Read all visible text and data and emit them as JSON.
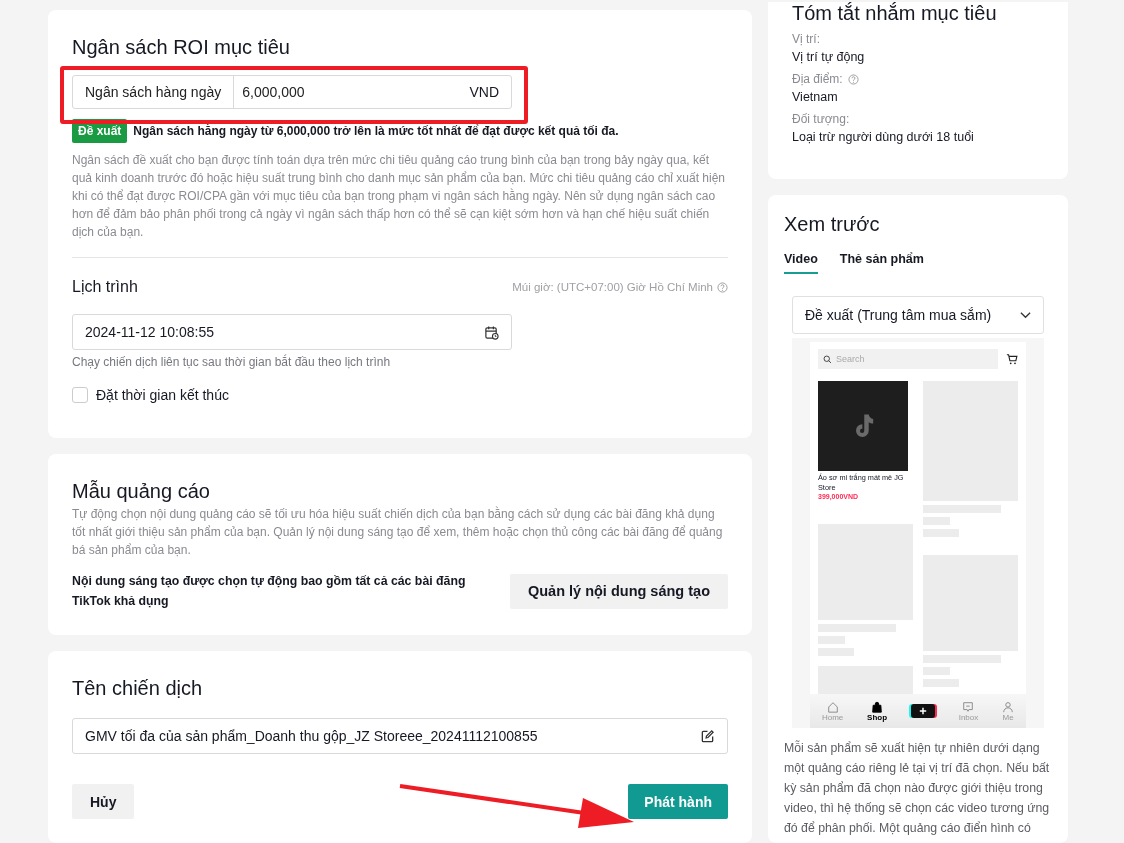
{
  "budget_card": {
    "title": "Ngân sách ROI mục tiêu",
    "budget_field": {
      "label": "Ngân sách hàng ngày",
      "value": "6,000,000",
      "unit": "VND"
    },
    "suggestion": {
      "badge": "Đề xuất",
      "text": "Ngân sách hằng ngày từ 6,000,000 trở lên là mức tốt nhất để đạt được kết quả tối đa."
    },
    "description": "Ngân sách đề xuất cho bạn được tính toán dựa trên mức chi tiêu quảng cáo trung bình của bạn trong bảy ngày qua, kết quả kinh doanh trước đó hoặc hiệu suất trung bình cho danh mục sản phẩm của bạn. Mức chi tiêu quảng cáo chỉ xuất hiện khi có thể đạt được ROI/CPA gần với mục tiêu của bạn trong phạm vi ngân sách hằng ngày. Nên sử dụng ngân sách cao hơn để đảm bảo phân phối trong cả ngày vì ngân sách thấp hơn có thể sẽ cạn kiệt sớm hơn và hạn chế hiệu suất chiến dịch của bạn.",
    "schedule": {
      "title": "Lịch trình",
      "timezone": "Múi giờ: (UTC+07:00) Giờ Hồ Chí Minh",
      "start_value": "2024-11-12 10:08:55",
      "hint": "Chạy chiến dịch liên tục sau thời gian bắt đầu theo lịch trình",
      "end_time": {
        "label": "Đặt thời gian kết thúc",
        "checked": false
      }
    }
  },
  "creative_card": {
    "title": "Mẫu quảng cáo",
    "description": "Tự động chọn nội dung quảng cáo sẽ tối ưu hóa hiệu suất chiến dịch của bạn bằng cách sử dụng các bài đăng khả dụng tốt nhất giới thiệu sản phẩm của bạn. Quản lý nội dung sáng tạo để xem, thêm hoặc chọn thủ công các bài đăng để quảng bá sản phẩm của bạn.",
    "note": "Nội dung sáng tạo được chọn tự động bao gồm tất cả các bài đăng TikTok khả dụng",
    "manage_button": "Quản lý nội dung sáng tạo"
  },
  "name_card": {
    "title": "Tên chiến dịch",
    "name_value": "GMV tối đa của sản phẩm_Doanh thu gộp_JZ Storeee_20241112100855",
    "cancel_button": "Hủy",
    "publish_button": "Phát hành"
  },
  "summary_card": {
    "title": "Tóm tắt nhắm mục tiêu",
    "items": [
      {
        "label": "Vị trí:",
        "value": "Vị trí tự động",
        "help": false
      },
      {
        "label": "Địa điểm:",
        "value": "Vietnam",
        "help": true
      },
      {
        "label": "Đối tượng:",
        "value": "Loại trừ người dùng dưới 18 tuổi",
        "help": false
      }
    ]
  },
  "preview_card": {
    "title": "Xem trước",
    "tabs": [
      {
        "label": "Video",
        "selected": true
      },
      {
        "label": "Thẻ sản phẩm",
        "selected": false
      }
    ],
    "placement_select": "Đề xuất (Trung tâm mua sắm)",
    "phone": {
      "search_placeholder": "Search",
      "product": {
        "name": "Áo sơ mi trắng mát mẻ JG Store",
        "price": "399,000VND"
      },
      "nav": [
        {
          "kind": "home",
          "label": "Home",
          "selected": false
        },
        {
          "kind": "shop",
          "label": "Shop",
          "selected": true
        },
        {
          "kind": "create",
          "selected": false
        },
        {
          "kind": "inbox",
          "label": "Inbox",
          "selected": false
        },
        {
          "kind": "me",
          "label": "Me",
          "selected": false
        }
      ]
    },
    "description": "Mỗi sản phẩm sẽ xuất hiện tự nhiên dưới dạng một quảng cáo riêng lẻ tại vị trí đã chọn. Nếu bất kỳ sản phẩm đã chọn nào được giới thiệu trong video, thì hệ thống sẽ chọn các video tương ứng đó để phân phối. Một quảng cáo điển hình có"
  }
}
